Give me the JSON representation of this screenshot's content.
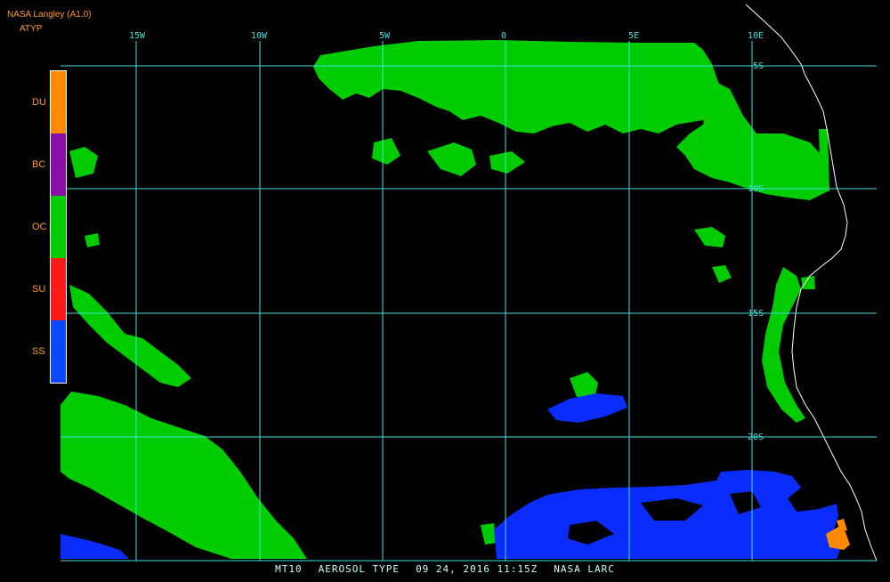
{
  "header": {
    "title": "NASA Langley (A1.0)",
    "product": "ATYP"
  },
  "legend": {
    "items": [
      {
        "label": "DU",
        "color": "#ff8a00"
      },
      {
        "label": "BC",
        "color": "#8a0fa8"
      },
      {
        "label": "OC",
        "color": "#00cc00"
      },
      {
        "label": "SU",
        "color": "#ff1a1a"
      },
      {
        "label": "SS",
        "color": "#0a47ff"
      }
    ]
  },
  "grid": {
    "longitudes": [
      "15W",
      "10W",
      "5W",
      "0",
      "5E",
      "10E"
    ],
    "latitudes": [
      "5S",
      "10S",
      "15S",
      "20S"
    ],
    "color": "#40e0e0"
  },
  "footer": {
    "satellite": "MT10",
    "product": "AEROSOL TYPE",
    "date": "09 24, 2016",
    "time": "11:15Z",
    "source": "NASA LARC"
  },
  "colors": {
    "background": "#000000",
    "oc": "#00cc00",
    "ss": "#0a2cff",
    "du": "#ff8a00",
    "coastline": "#ffffff"
  }
}
